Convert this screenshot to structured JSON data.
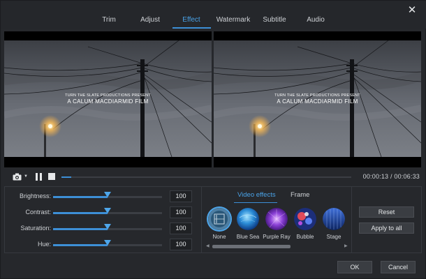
{
  "window": {
    "close_glyph": "✕"
  },
  "tabs": [
    {
      "label": "Trim"
    },
    {
      "label": "Adjust"
    },
    {
      "label": "Effect"
    },
    {
      "label": "Watermark"
    },
    {
      "label": "Subtitle"
    },
    {
      "label": "Audio"
    }
  ],
  "active_tab": "Effect",
  "preview": {
    "credit_line_1": "TURN THE SLATE PRODUCTIONS PRESENT",
    "credit_line_2": "A CALUM MACDIARMID FILM"
  },
  "playback": {
    "camera_icon": "camera-icon",
    "dropdown_glyph": "▼",
    "timecode": "00:00:13 / 00:06:33",
    "progress_fraction": 0.033
  },
  "adjust": {
    "rows": [
      {
        "label": "Brightness:",
        "value": "100",
        "level": 0.5
      },
      {
        "label": "Contrast:",
        "value": "100",
        "level": 0.5
      },
      {
        "label": "Saturation:",
        "value": "100",
        "level": 0.5
      },
      {
        "label": "Hue:",
        "value": "100",
        "level": 0.5
      }
    ]
  },
  "effects": {
    "tabs": [
      {
        "label": "Video effects"
      },
      {
        "label": "Frame"
      }
    ],
    "active_tab": "Video effects",
    "items": [
      {
        "label": "None",
        "selected": true
      },
      {
        "label": "Blue Sea"
      },
      {
        "label": "Purple Ray"
      },
      {
        "label": "Bubble"
      },
      {
        "label": "Stage"
      }
    ],
    "scroll_left_glyph": "◀",
    "scroll_right_glyph": "▶"
  },
  "actions": {
    "reset": "Reset",
    "apply_all": "Apply to all"
  },
  "footer": {
    "ok": "OK",
    "cancel": "Cancel"
  },
  "colors": {
    "accent": "#3d8fd6",
    "background": "#26282c"
  }
}
